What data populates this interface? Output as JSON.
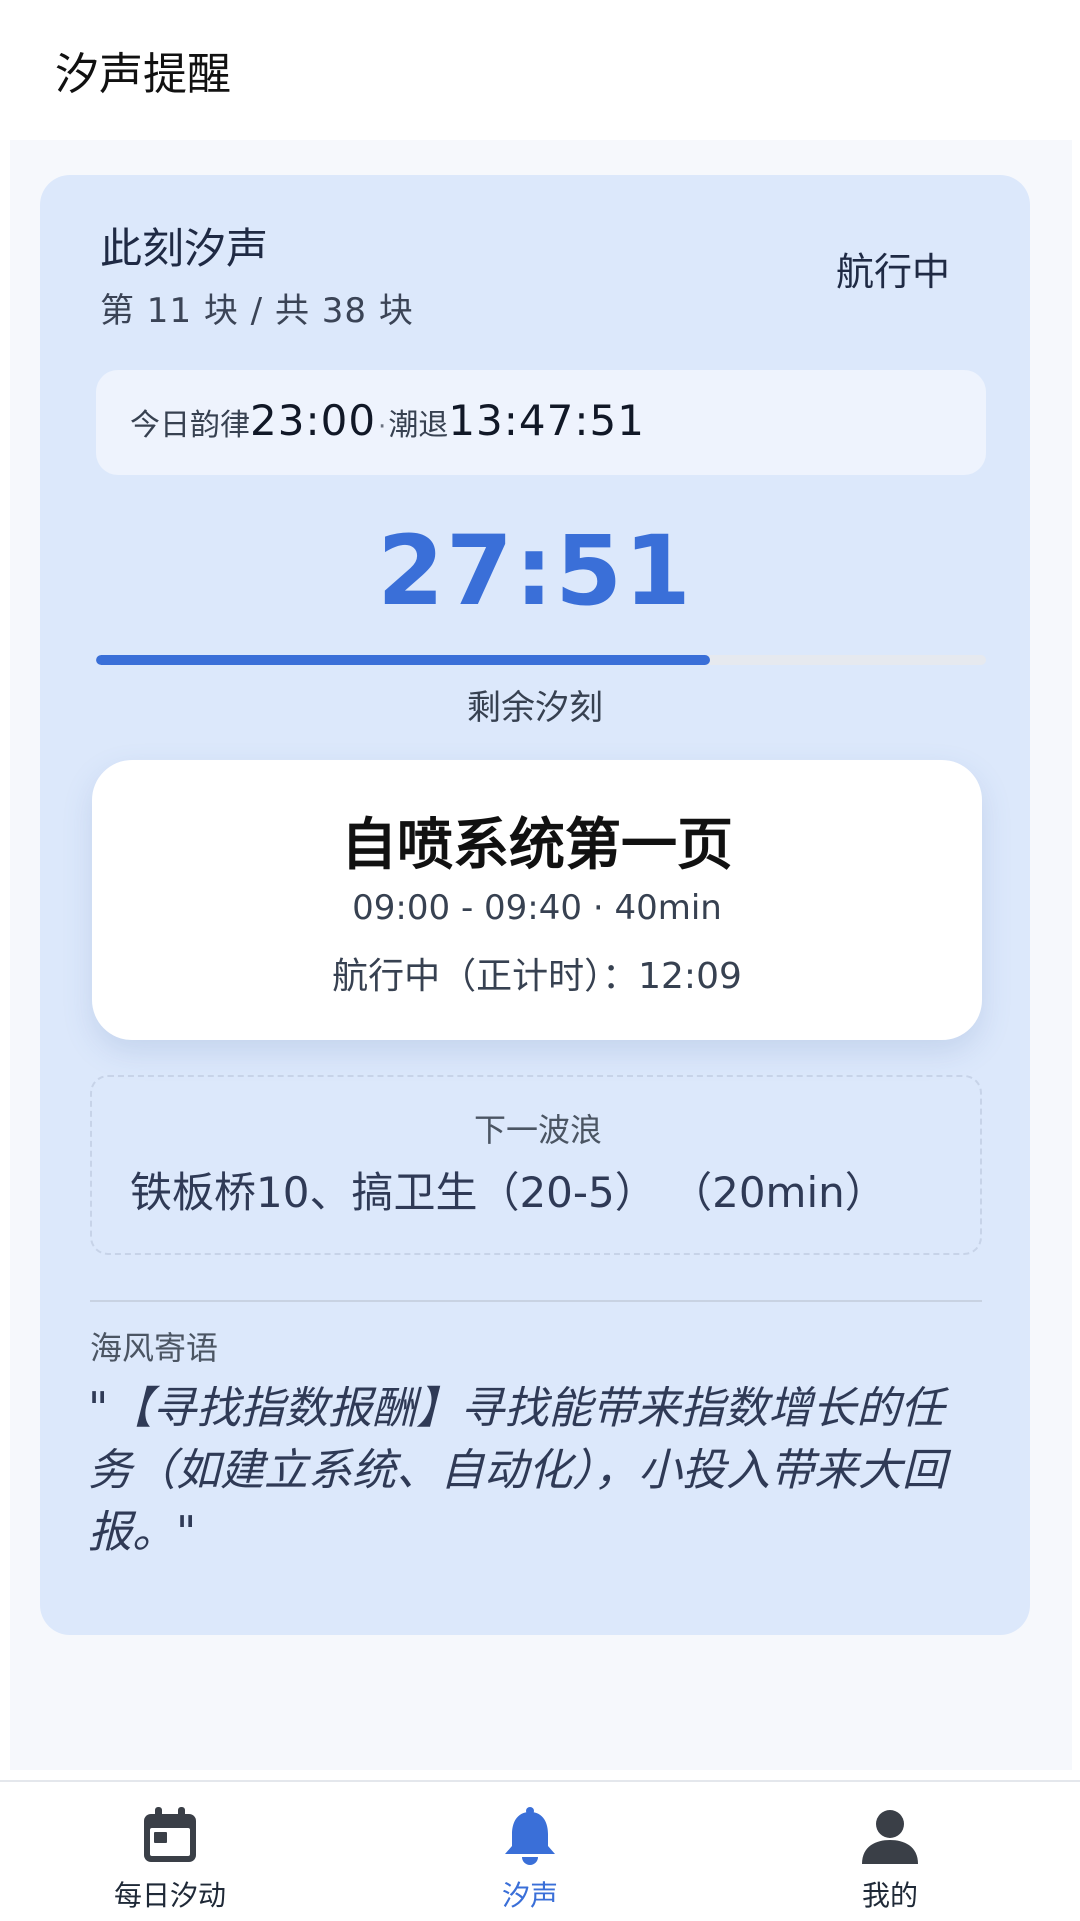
{
  "header": {
    "title": "汐声提醒"
  },
  "card": {
    "title": "此刻汐声",
    "block_count": "第 11 块 / 共 38 块",
    "status": "航行中",
    "rhythm": {
      "label": "今日韵律",
      "time": "23:00",
      "sep": "·",
      "ebb_label": "潮退",
      "ebb_value": "13:47:51"
    },
    "countdown": "27:51",
    "progress": 0.69,
    "progress_label": "剩余汐刻"
  },
  "task": {
    "title": "自喷系统第一页",
    "time": "09:00 - 09:40 · 40min",
    "elapsed": "航行中（正计时）：12:09"
  },
  "next": {
    "label": "下一波浪",
    "task": "铁板桥10、搞卫生（20-5）  （20min）"
  },
  "quote": {
    "label": "海风寄语",
    "text": "\"【寻找指数报酬】寻找能带来指数增长的任务（如建立系统、自动化），小投入带来大回报。\""
  },
  "tabs": [
    {
      "label": "每日汐动",
      "icon": "calendar-icon"
    },
    {
      "label": "汐声",
      "icon": "bell-icon",
      "active": true
    },
    {
      "label": "我的",
      "icon": "person-icon"
    }
  ],
  "colors": {
    "accent": "#3a6fd8",
    "card_bg": "#dce8fb"
  }
}
